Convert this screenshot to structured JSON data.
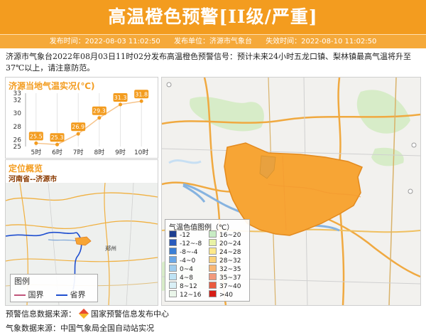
{
  "header": {
    "title": "高温橙色预警[II级/严重]",
    "publish_time_label": "发布时间：2022-08-03 11:02:50",
    "publisher_label": "发布单位：济源市气象台",
    "expire_label": "失效时间：2022-08-10 11:02:50"
  },
  "description": "济源市气象台2022年08月03日11时02分发布高温橙色预警信号：预计未来24小时五龙口镇、梨林镇最高气温将升至37℃以上，请注意防范。",
  "temp_panel": {
    "title": "济源当地气温实况(℃)"
  },
  "chart_data": {
    "type": "line",
    "title": "济源当地气温实况(℃)",
    "categories": [
      "5时",
      "6时",
      "7时",
      "8时",
      "9时",
      "10时"
    ],
    "values": [
      25.5,
      25.3,
      26.9,
      29.3,
      31.3,
      31.8
    ],
    "y_ticks": [
      "33",
      "32",
      "30",
      "28",
      "26",
      "25"
    ],
    "ylim": [
      25,
      33
    ],
    "grid": true
  },
  "locate_panel": {
    "title": "定位概览",
    "region": "河南省--济源市",
    "place_label": "郑州"
  },
  "locate_legend": {
    "title": "图例",
    "items": [
      {
        "label": "国界",
        "color": "#c0557a"
      },
      {
        "label": "省界",
        "color": "#1f4fd0"
      }
    ]
  },
  "temp_legend": {
    "title": "气温色值图例（℃）",
    "left": [
      {
        "label": "-12",
        "color": "#1e3e8f"
      },
      {
        "label": "-12~-8",
        "color": "#2a5bbd"
      },
      {
        "label": "-8~-4",
        "color": "#3b7fd6"
      },
      {
        "label": "-4~0",
        "color": "#6ba7e6"
      },
      {
        "label": "0~4",
        "color": "#9fcdee"
      },
      {
        "label": "4~8",
        "color": "#bfe3f4"
      },
      {
        "label": "8~12",
        "color": "#d9f0f6"
      },
      {
        "label": "12~16",
        "color": "#eaf6ea"
      }
    ],
    "right": [
      {
        "label": "16~20",
        "color": "#c8ecc4"
      },
      {
        "label": "20~24",
        "color": "#e8f2a6"
      },
      {
        "label": "24~28",
        "color": "#fde98b"
      },
      {
        "label": "28~32",
        "color": "#fbd27a"
      },
      {
        "label": "32~35",
        "color": "#f9b774"
      },
      {
        "label": "35~37",
        "color": "#f29a7c"
      },
      {
        "label": "37~40",
        "color": "#ea5b3e"
      },
      {
        "label": ">40",
        "color": "#d61e16"
      }
    ]
  },
  "footer": {
    "source1": "预警信息数据来源：",
    "source1_org": "国家预警信息发布中心",
    "source2": "气象数据来源：中国气象局全国自动站实况"
  },
  "colors": {
    "accent": "#f39c1f",
    "warning_area": "#f7a535"
  }
}
